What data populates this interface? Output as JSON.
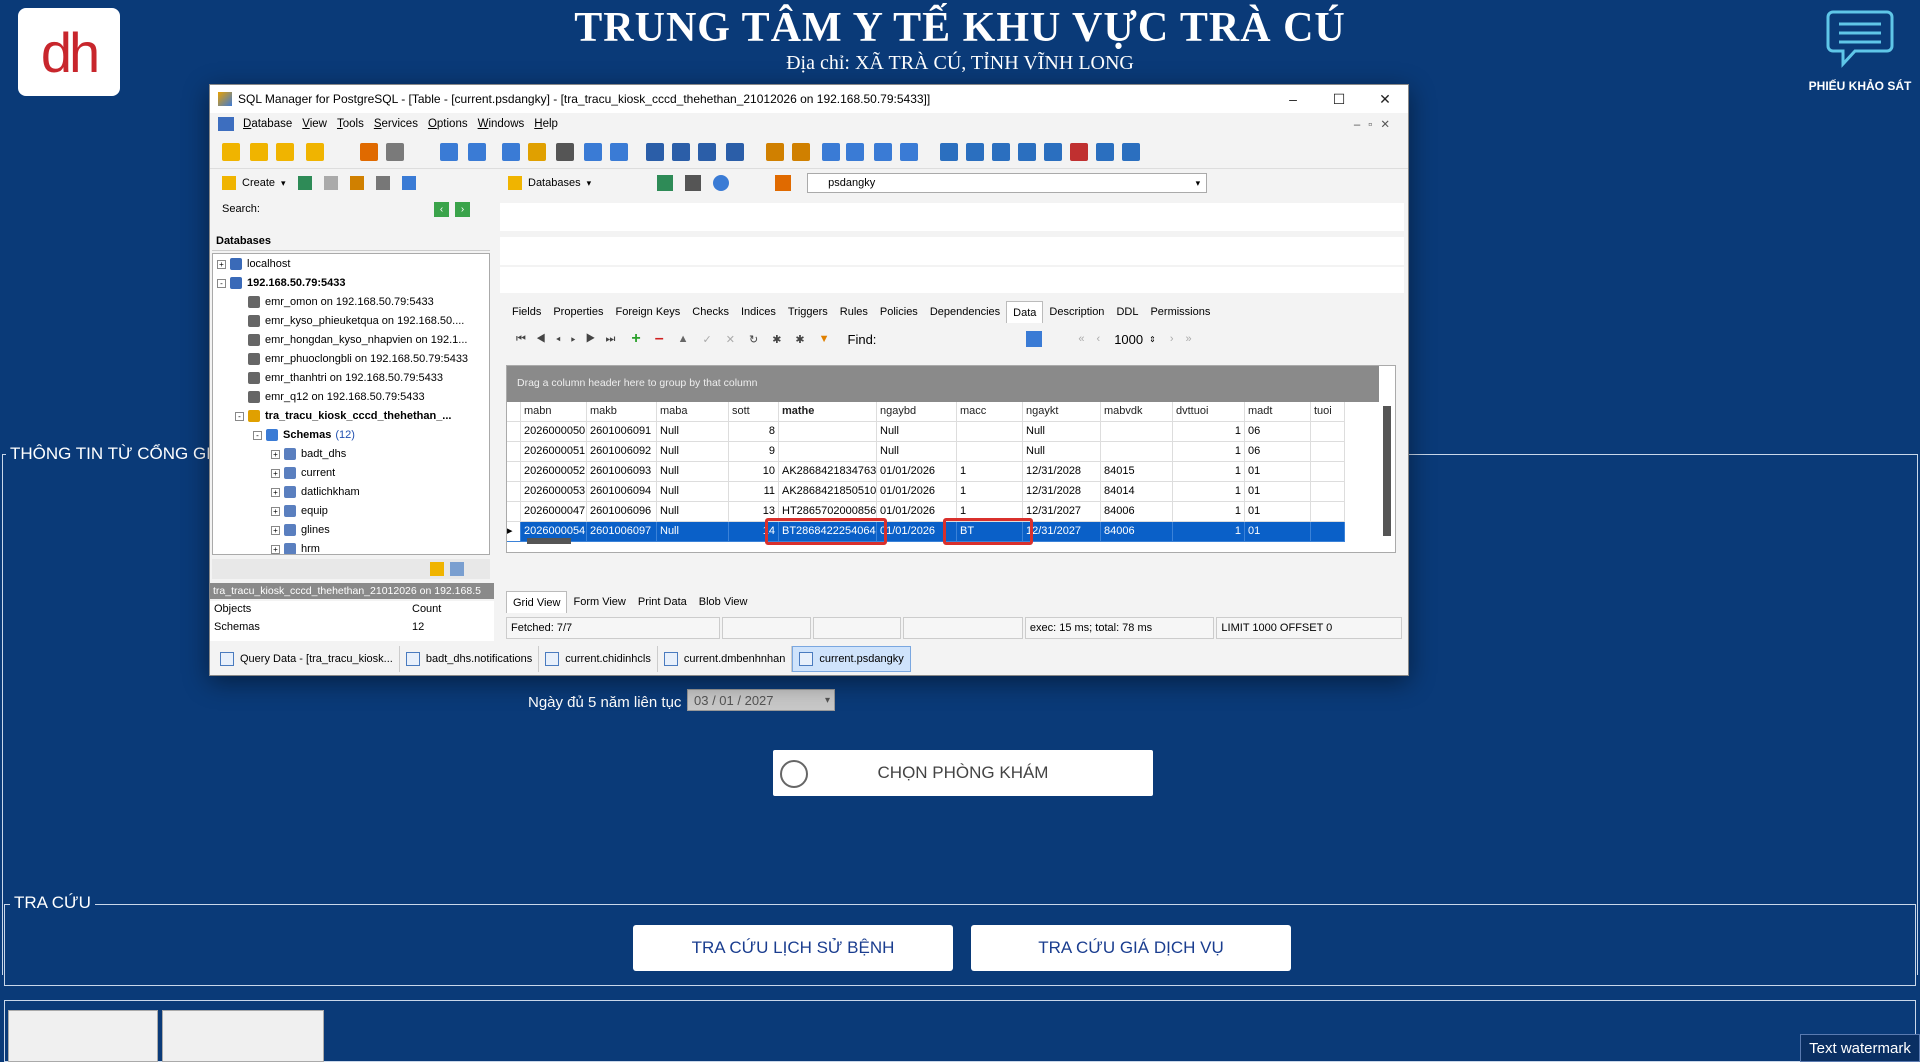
{
  "kiosk": {
    "logo_text": "dh",
    "title": "TRUNG TÂM Y TẾ KHU VỰC TRÀ CÚ",
    "address": "Địa chỉ: XÃ TRÀ CÚ, TỈNH VĨNH LONG",
    "survey_label": "PHIẾU KHẢO SÁT",
    "section1_legend": "THÔNG TIN TỪ CỔNG GIÁM",
    "date_label": "Ngày đủ 5 năm liên tục :",
    "date_value": "03 / 01 / 2027",
    "choose_room_button": "CHỌN PHÒNG KHÁM",
    "section2_legend": "TRA CỨU",
    "history_button": "TRA CỨU LỊCH SỬ BỆNH",
    "price_button": "TRA CỨU GIÁ DỊCH VỤ",
    "watermark": "Text watermark"
  },
  "window": {
    "title": "SQL Manager for PostgreSQL - [Table - [current.psdangky] - [tra_tracu_kiosk_cccd_thehethan_21012026 on 192.168.50.79:5433]]",
    "menu": [
      "Database",
      "View",
      "Tools",
      "Services",
      "Options",
      "Windows",
      "Help"
    ],
    "create_label": "Create",
    "databases_label": "Databases",
    "db_combo_value": "psdangky",
    "search_label": "Search:",
    "databases_header": "Databases",
    "tree": [
      {
        "label": "localhost",
        "level": 0,
        "exp": "+",
        "kind": "host"
      },
      {
        "label": "192.168.50.79:5433",
        "level": 0,
        "exp": "-",
        "kind": "host",
        "bold": true
      },
      {
        "label": "emr_omon on 192.168.50.79:5433",
        "level": 1,
        "kind": "db"
      },
      {
        "label": "emr_kyso_phieuketqua on 192.168.50....",
        "level": 1,
        "kind": "db"
      },
      {
        "label": "emr_hongdan_kyso_nhapvien on 192.1...",
        "level": 1,
        "kind": "db"
      },
      {
        "label": "emr_phuoclongbli on 192.168.50.79:5433",
        "level": 1,
        "kind": "db"
      },
      {
        "label": "emr_thanhtri on 192.168.50.79:5433",
        "level": 1,
        "kind": "db"
      },
      {
        "label": "emr_q12 on 192.168.50.79:5433",
        "level": 1,
        "kind": "db"
      },
      {
        "label": "tra_tracu_kiosk_cccd_thehethan_...",
        "level": 1,
        "exp": "-",
        "kind": "dbopen",
        "bold": true
      },
      {
        "label": "Schemas",
        "count": "(12)",
        "level": 2,
        "exp": "-",
        "kind": "folder",
        "bold": true
      },
      {
        "label": "badt_dhs",
        "level": 3,
        "exp": "+",
        "kind": "schema"
      },
      {
        "label": "current",
        "level": 3,
        "exp": "+",
        "kind": "schema"
      },
      {
        "label": "datlichkham",
        "level": 3,
        "exp": "+",
        "kind": "schema"
      },
      {
        "label": "equip",
        "level": 3,
        "exp": "+",
        "kind": "schema"
      },
      {
        "label": "glines",
        "level": 3,
        "exp": "+",
        "kind": "schema"
      },
      {
        "label": "hrm",
        "level": 3,
        "exp": "+",
        "kind": "schema"
      }
    ],
    "bottom_panel_title": "tra_tracu_kiosk_cccd_thehethan_21012026 on 192.168.5",
    "objects_header": [
      "Objects",
      "Count"
    ],
    "objects_row": [
      "Schemas",
      "12"
    ],
    "tabs": [
      "Fields",
      "Properties",
      "Foreign Keys",
      "Checks",
      "Indices",
      "Triggers",
      "Rules",
      "Policies",
      "Dependencies",
      "Data",
      "Description",
      "DDL",
      "Permissions"
    ],
    "active_tab": "Data",
    "find_label": "Find:",
    "limit_value": "1000",
    "group_hint": "Drag a column header here to group by that column",
    "columns": [
      "mabn",
      "makb",
      "maba",
      "sott",
      "mathe",
      "ngaybd",
      "macc",
      "ngaykt",
      "mabvdk",
      "dvttuoi",
      "madt",
      "tuoi"
    ],
    "rows": [
      [
        "2026000050",
        "2601006091",
        "Null",
        "8",
        "",
        "Null",
        "",
        "Null",
        "",
        "1",
        "06",
        ""
      ],
      [
        "2026000051",
        "2601006092",
        "Null",
        "9",
        "",
        "Null",
        "",
        "Null",
        "",
        "1",
        "06",
        ""
      ],
      [
        "2026000052",
        "2601006093",
        "Null",
        "10",
        "AK2868421834763",
        "01/01/2026",
        "1",
        "12/31/2028",
        "84015",
        "1",
        "01",
        ""
      ],
      [
        "2026000053",
        "2601006094",
        "Null",
        "11",
        "AK2868421850510",
        "01/01/2026",
        "1",
        "12/31/2028",
        "84014",
        "1",
        "01",
        ""
      ],
      [
        "2026000047",
        "2601006096",
        "Null",
        "13",
        "HT2865702000856",
        "01/01/2026",
        "1",
        "12/31/2027",
        "84006",
        "1",
        "01",
        ""
      ],
      [
        "2026000054",
        "2601006097",
        "Null",
        "14",
        "BT2868422254064",
        "01/01/2026",
        "BT",
        "12/31/2027",
        "84006",
        "1",
        "01",
        ""
      ]
    ],
    "view_tabs": [
      "Grid View",
      "Form View",
      "Print Data",
      "Blob View"
    ],
    "status": {
      "fetched": "Fetched: 7/7",
      "exec": "exec: 15 ms; total: 78 ms",
      "limit": "LIMIT 1000 OFFSET 0"
    },
    "window_tabs": [
      "Query Data - [tra_tracu_kiosk...",
      "badt_dhs.notifications",
      "current.chidinhcls",
      "current.dmbenhnhan",
      "current.psdangky"
    ],
    "active_window_tab": "current.psdangky"
  }
}
